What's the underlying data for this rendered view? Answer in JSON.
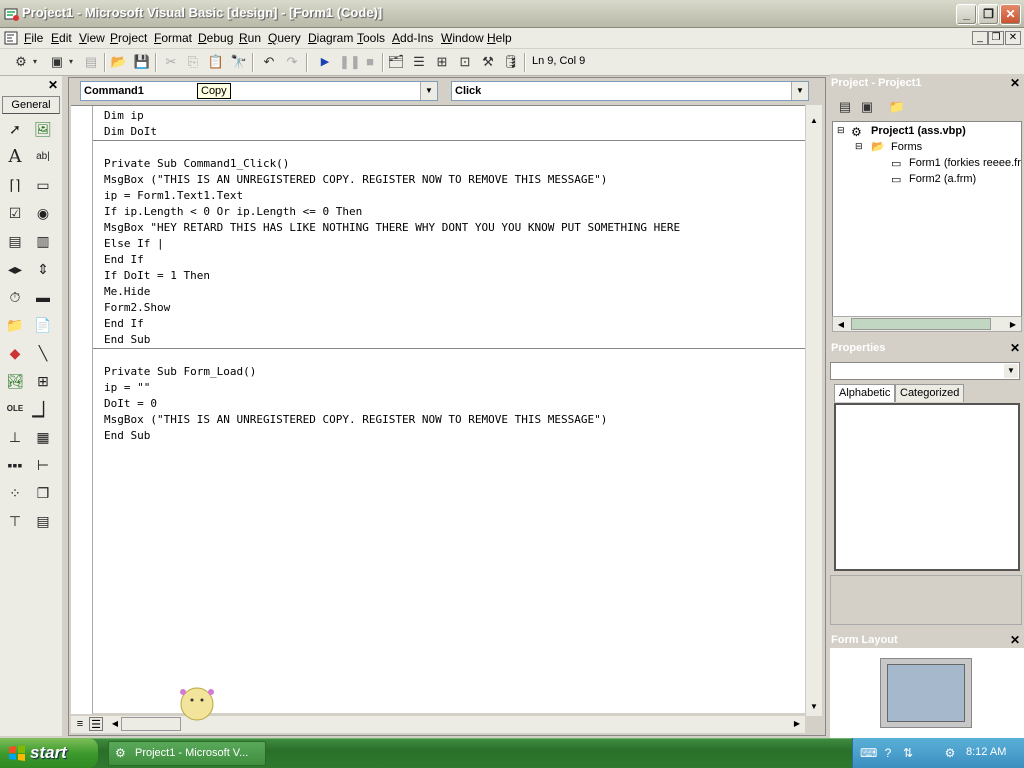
{
  "window": {
    "title": "Project1 - Microsoft Visual Basic [design] - [Form1 (Code)]"
  },
  "menu": [
    "File",
    "Edit",
    "View",
    "Project",
    "Format",
    "Debug",
    "Run",
    "Query",
    "Diagram",
    "Tools",
    "Add-Ins",
    "Window",
    "Help"
  ],
  "toolbar": {
    "position": "Ln 9, Col 9"
  },
  "toolbox": {
    "tab": "General"
  },
  "code_window": {
    "object_combo": "Command1",
    "procedure_combo": "Click",
    "tooltip": "Copy",
    "lines": [
      "Dim ip",
      "Dim DoIt",
      "",
      "Private Sub Command1_Click()",
      "MsgBox (\"THIS IS AN UNREGISTERED COPY. REGISTER NOW TO REMOVE THIS MESSAGE\")",
      "ip = Form1.Text1.Text",
      "If ip.Length < 0 Or ip.Length <= 0 Then",
      "MsgBox \"HEY RETARD THIS HAS LIKE NOTHING THERE WHY DONT YOU YOU KNOW PUT SOMETHING HERE",
      "Else If |",
      "End If",
      "If DoIt = 1 Then",
      "Me.Hide",
      "Form2.Show",
      "End If",
      "End Sub",
      "",
      "Private Sub Form_Load()",
      "ip = \"\"",
      "DoIt = 0",
      "MsgBox (\"THIS IS AN UNREGISTERED COPY. REGISTER NOW TO REMOVE THIS MESSAGE\")",
      "End Sub"
    ]
  },
  "project_panel": {
    "title": "Project - Project1",
    "root": "Project1 (ass.vbp)",
    "folder": "Forms",
    "items": [
      "Form1 (forkies reeee.fr",
      "Form2 (a.frm)"
    ]
  },
  "properties_panel": {
    "title": "Properties",
    "tabs": [
      "Alphabetic",
      "Categorized"
    ]
  },
  "form_layout_panel": {
    "title": "Form Layout"
  },
  "taskbar": {
    "start": "start",
    "task": "Project1 - Microsoft V...",
    "clock": "8:12 AM"
  }
}
